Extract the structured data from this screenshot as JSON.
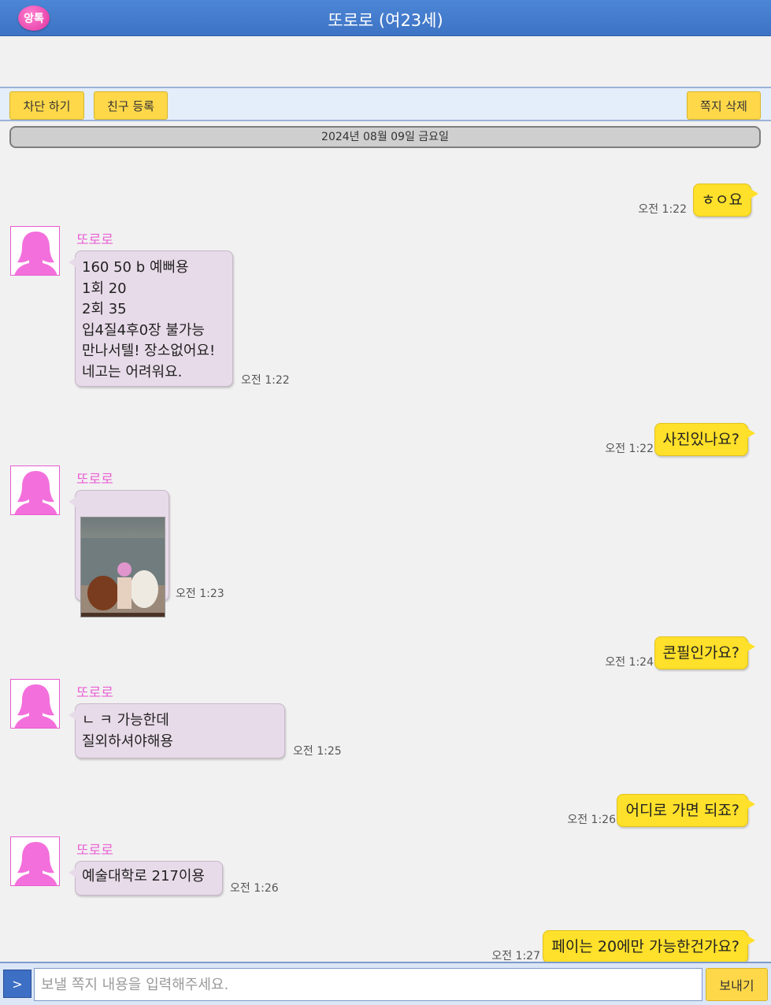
{
  "header": {
    "logo_text": "앙톡",
    "title": "또로로 (여23세)"
  },
  "toolbar": {
    "block_label": "차단 하기",
    "add_friend_label": "친구 등록",
    "delete_label": "쪽지 삭제"
  },
  "date_label": "2024년 08월 09일 금요일",
  "sender_name": "또로로",
  "messages": [
    {
      "dir": "out",
      "text": "ㅎㅇ요",
      "time": "오전 1:22"
    },
    {
      "dir": "in",
      "text": "160 50 b 예뻐용\n1회 20\n2회 35\n입4질4후0장 불가능\n만나서텔! 장소없어요!\n네고는 어려워요.",
      "time": "오전 1:22"
    },
    {
      "dir": "out",
      "text": "사진있나요?",
      "time": "오전 1:22"
    },
    {
      "dir": "in",
      "type": "photo",
      "time": "오전 1:23"
    },
    {
      "dir": "out",
      "text": "콘필인가요?",
      "time": "오전 1:24"
    },
    {
      "dir": "in",
      "text": "ㄴ ㅋ 가능한데\n질외하셔야해용",
      "time": "오전 1:25"
    },
    {
      "dir": "out",
      "text": "어디로 가면 되죠?",
      "time": "오전 1:26"
    },
    {
      "dir": "in",
      "text": "예술대학로 217이용",
      "time": "오전 1:26"
    },
    {
      "dir": "out",
      "text": "페이는 20에만 가능한건가요?",
      "time": "오전 1:27"
    }
  ],
  "composer": {
    "expand_label": ">",
    "placeholder": "보낼 쪽지 내용을 입력해주세요.",
    "value": "",
    "send_label": "보내기"
  },
  "colors": {
    "header": "#3d73c4",
    "incoming_bubble": "#e8dbe9",
    "outgoing_bubble": "#ffe02a",
    "sender_name": "#e95fd4",
    "button": "#ffd84a"
  }
}
